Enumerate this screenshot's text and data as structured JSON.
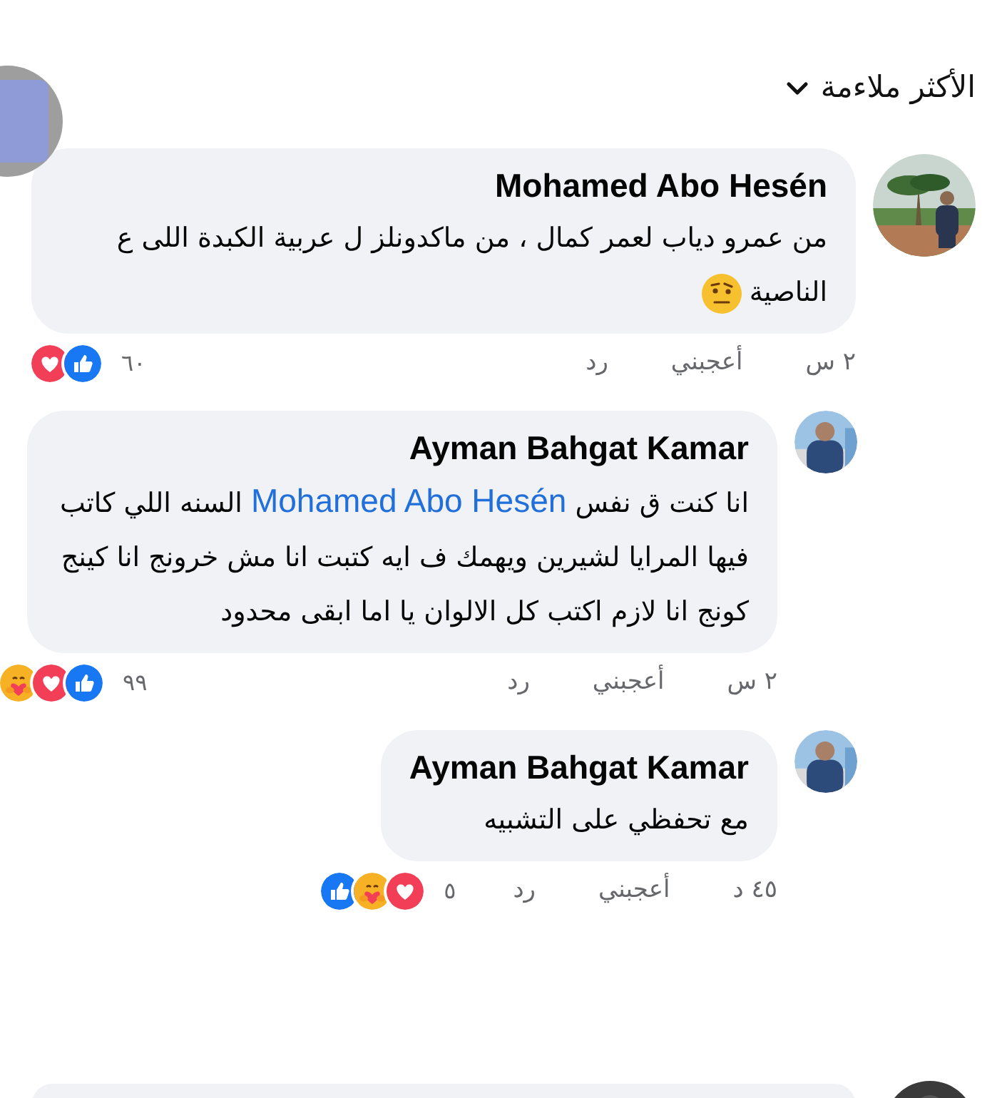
{
  "sort": {
    "label": "الأكثر ملاءمة"
  },
  "comments": [
    {
      "kind": "comment",
      "author": "Mohamed Abo Hesén",
      "body": [
        {
          "kind": "text",
          "text": "من عمرو دياب لعمر كمال ، من ماكدونلز ل عربية الكبدة اللى ع الناصية"
        },
        {
          "kind": "emoji"
        }
      ],
      "time": "٢ س",
      "like": "أعجبني",
      "reply": "رد",
      "count": "٦٠",
      "reactions": [
        {
          "kind": "love"
        },
        {
          "kind": "like"
        }
      ]
    },
    {
      "kind": "reply",
      "author": "Ayman Bahgat Kamar",
      "body": [
        {
          "kind": "text",
          "text": "انا كنت ق نفس "
        },
        {
          "kind": "mention",
          "text": "Mohamed Abo Hesén"
        },
        {
          "kind": "text",
          "text": " السنه اللي كاتب فيها المرايا لشيرين ويهمك ف ايه كتبت انا مش خرونج انا كينج كونج انا لازم اكتب كل الالوان يا اما ابقى محدود"
        }
      ],
      "time": "٢ س",
      "like": "أعجبني",
      "reply": "رد",
      "count": "٩٩",
      "reactions": [
        {
          "kind": "care"
        },
        {
          "kind": "love"
        },
        {
          "kind": "like"
        }
      ]
    },
    {
      "kind": "reply",
      "author": "Ayman Bahgat Kamar",
      "body": [
        {
          "kind": "text",
          "text": "مع تحفظي على التشبيه"
        }
      ],
      "time": "٤٥ د",
      "like": "أعجبني",
      "reply": "رد",
      "count": "٥",
      "reactions": [
        {
          "kind": "like"
        },
        {
          "kind": "care"
        },
        {
          "kind": "love"
        }
      ]
    }
  ]
}
